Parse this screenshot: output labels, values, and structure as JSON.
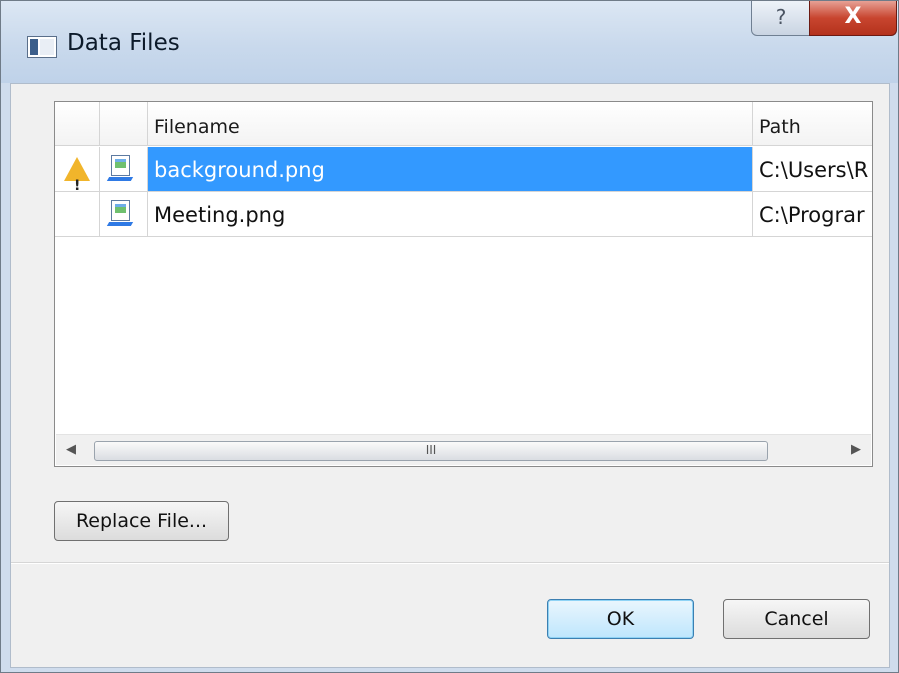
{
  "window": {
    "title": "Data Files",
    "help_label": "?",
    "close_label": "X"
  },
  "grid": {
    "columns": [
      "",
      "",
      "Filename",
      "Path"
    ],
    "rows": [
      {
        "status": "warning",
        "filename": "background.png",
        "path": "C:\\Users\\R",
        "selected": true
      },
      {
        "status": "",
        "filename": "Meeting.png",
        "path": "C:\\Prograr",
        "selected": false
      }
    ],
    "scroll_grip": "III"
  },
  "buttons": {
    "replace": "Replace File...",
    "ok": "OK",
    "cancel": "Cancel"
  },
  "icons": {
    "warning": "warning-icon",
    "image_file": "image-file-icon",
    "scroll_left": "scroll-left-arrow-icon",
    "scroll_right": "scroll-right-arrow-icon"
  },
  "colors": {
    "selection": "#3399ff",
    "warning": "#f1b52b",
    "close": "#c8452f"
  }
}
